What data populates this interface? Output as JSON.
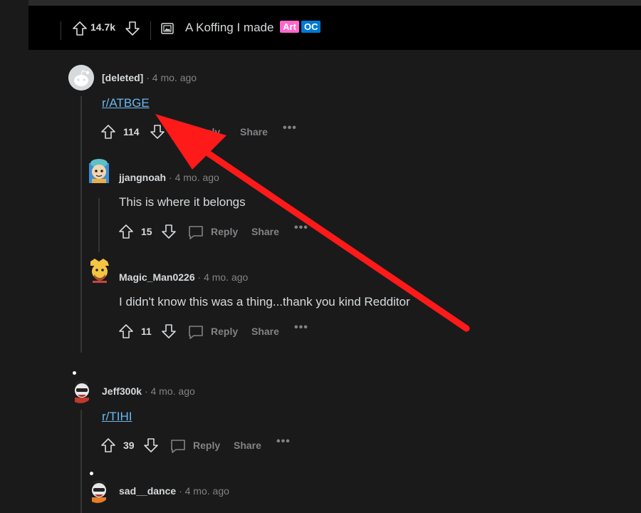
{
  "post": {
    "score": "14.7k",
    "title": "A Koffing I made",
    "flairs": [
      {
        "label": "Art",
        "color": "#ff66cc"
      },
      {
        "label": "OC",
        "color": "#0079d3"
      }
    ]
  },
  "comments": [
    {
      "user": "[deleted]",
      "time": "4 mo. ago",
      "body": "r/ATBGE",
      "is_link": true,
      "votes": "114",
      "reply": "Reply",
      "share": "Share",
      "more": "•••"
    },
    {
      "user": "jjangnoah",
      "time": "4 mo. ago",
      "body": "This is where it belongs",
      "is_link": false,
      "votes": "15",
      "reply": "Reply",
      "share": "Share",
      "more": "•••"
    },
    {
      "user": "Magic_Man0226",
      "time": "4 mo. ago",
      "body": "I didn't know this was a thing...thank you kind Redditor",
      "is_link": false,
      "votes": "11",
      "reply": "Reply",
      "share": "Share",
      "more": "•••"
    },
    {
      "user": "Jeff300k",
      "time": "4 mo. ago",
      "body": "r/TIHI",
      "is_link": true,
      "votes": "39",
      "reply": "Reply",
      "share": "Share",
      "more": "•••"
    },
    {
      "user": "sad__dance",
      "time": "4 mo. ago",
      "body": "",
      "is_link": false
    }
  ],
  "sep_dot": "·",
  "colors": {
    "background": "#1a1a1b",
    "topbar": "#000000",
    "link": "#6cb7ee",
    "annotation_arrow": "#ff1a1a",
    "muted": "#818384",
    "text": "#d7dadc"
  },
  "icons": [
    "upvote-icon",
    "downvote-icon",
    "image-post-icon",
    "comment-icon",
    "more-icon",
    "annotation-arrow"
  ]
}
